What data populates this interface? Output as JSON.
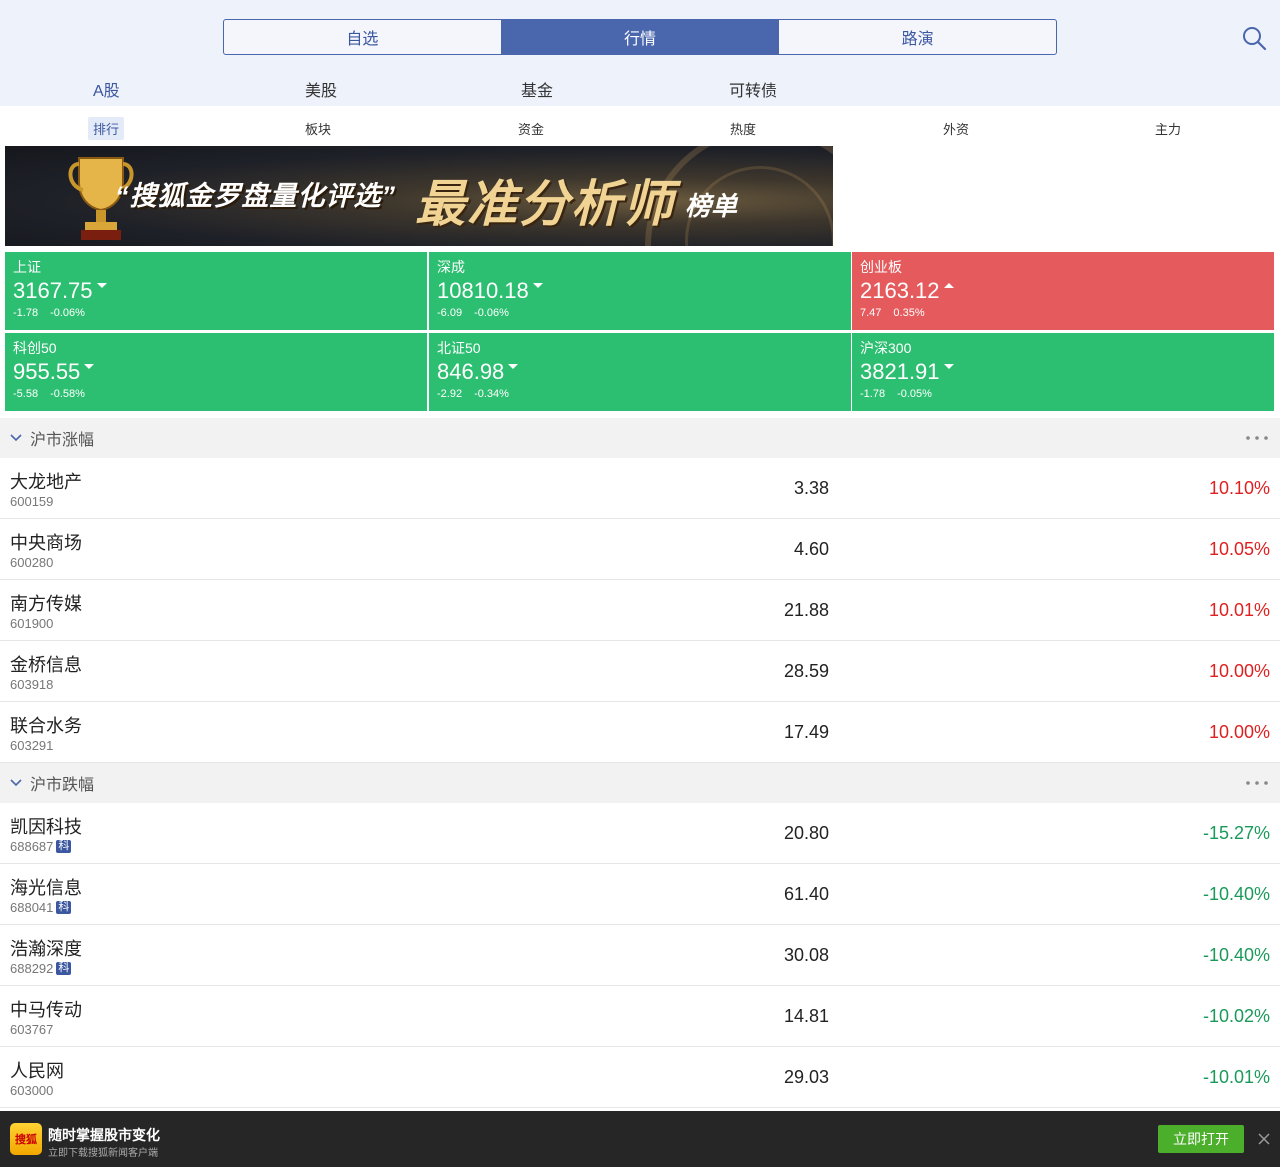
{
  "nav": {
    "segments": [
      "自选",
      "行情",
      "路演"
    ],
    "active_segment": "行情",
    "market_tabs": [
      "A股",
      "美股",
      "基金",
      "可转债"
    ],
    "active_market_tab": "A股",
    "sub_tabs": [
      "排行",
      "板块",
      "资金",
      "热度",
      "外资",
      "主力"
    ],
    "active_sub_tab": "排行"
  },
  "banner": {
    "title_quote": "“搜狐金罗盘量化评选”",
    "title_big": "最准分析师",
    "title_small": "榜单"
  },
  "indices": [
    {
      "name": "上证",
      "value": "3167.75",
      "change": "-1.78",
      "pct": "-0.06%",
      "direction": "down"
    },
    {
      "name": "深成",
      "value": "10810.18",
      "change": "-6.09",
      "pct": "-0.06%",
      "direction": "down"
    },
    {
      "name": "创业板",
      "value": "2163.12",
      "change": "7.47",
      "pct": "0.35%",
      "direction": "up"
    },
    {
      "name": "科创50",
      "value": "955.55",
      "change": "-5.58",
      "pct": "-0.58%",
      "direction": "down"
    },
    {
      "name": "北证50",
      "value": "846.98",
      "change": "-2.92",
      "pct": "-0.34%",
      "direction": "down"
    },
    {
      "name": "沪深300",
      "value": "3821.91",
      "change": "-1.78",
      "pct": "-0.05%",
      "direction": "down"
    }
  ],
  "colors": {
    "up": "#e55a5c",
    "down": "#2dbf71",
    "accent": "#4a66ad"
  },
  "sections": [
    {
      "title": "沪市涨幅",
      "rows": [
        {
          "name": "大龙地产",
          "code": "600159",
          "badge": "",
          "price": "3.38",
          "pct": "10.10%",
          "direction": "up"
        },
        {
          "name": "中央商场",
          "code": "600280",
          "badge": "",
          "price": "4.60",
          "pct": "10.05%",
          "direction": "up"
        },
        {
          "name": "南方传媒",
          "code": "601900",
          "badge": "",
          "price": "21.88",
          "pct": "10.01%",
          "direction": "up"
        },
        {
          "name": "金桥信息",
          "code": "603918",
          "badge": "",
          "price": "28.59",
          "pct": "10.00%",
          "direction": "up"
        },
        {
          "name": "联合水务",
          "code": "603291",
          "badge": "",
          "price": "17.49",
          "pct": "10.00%",
          "direction": "up"
        }
      ]
    },
    {
      "title": "沪市跌幅",
      "rows": [
        {
          "name": "凯因科技",
          "code": "688687",
          "badge": "科",
          "price": "20.80",
          "pct": "-15.27%",
          "direction": "down"
        },
        {
          "name": "海光信息",
          "code": "688041",
          "badge": "科",
          "price": "61.40",
          "pct": "-10.40%",
          "direction": "down"
        },
        {
          "name": "浩瀚深度",
          "code": "688292",
          "badge": "科",
          "price": "30.08",
          "pct": "-10.40%",
          "direction": "down"
        },
        {
          "name": "中马传动",
          "code": "603767",
          "badge": "",
          "price": "14.81",
          "pct": "-10.02%",
          "direction": "down"
        },
        {
          "name": "人民网",
          "code": "603000",
          "badge": "",
          "price": "29.03",
          "pct": "-10.01%",
          "direction": "down"
        }
      ]
    }
  ],
  "app_banner": {
    "icon_text": "搜狐",
    "title": "随时掌握股市变化",
    "subtitle": "立即下载搜狐新闻客户端",
    "open_label": "立即打开"
  }
}
